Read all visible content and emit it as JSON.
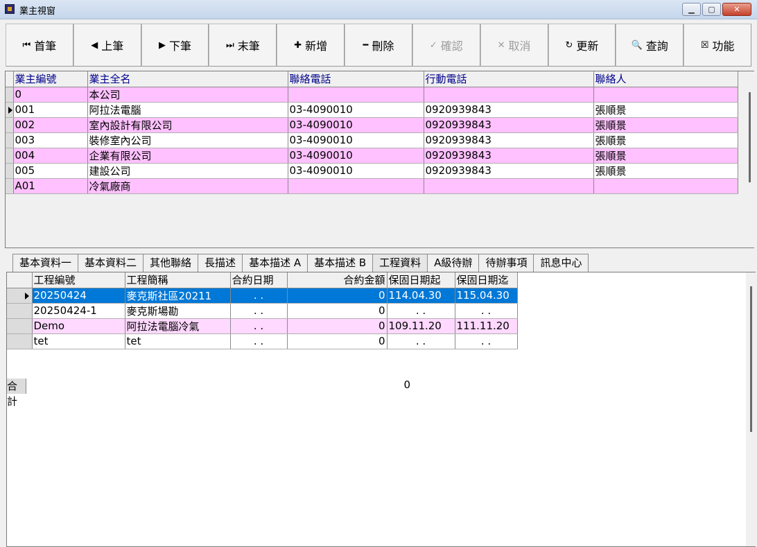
{
  "window": {
    "title": "業主視窗"
  },
  "toolbar": {
    "buttons": [
      {
        "icon": "⏮",
        "label": "首筆",
        "enabled": true
      },
      {
        "icon": "◀",
        "label": "上筆",
        "enabled": true
      },
      {
        "icon": "▶",
        "label": "下筆",
        "enabled": true
      },
      {
        "icon": "⏭",
        "label": "末筆",
        "enabled": true
      },
      {
        "icon": "✚",
        "label": "新增",
        "enabled": true
      },
      {
        "icon": "━",
        "label": "刪除",
        "enabled": true
      },
      {
        "icon": "✓",
        "label": "確認",
        "enabled": false
      },
      {
        "icon": "✕",
        "label": "取消",
        "enabled": false
      },
      {
        "icon": "↻",
        "label": "更新",
        "enabled": true
      },
      {
        "icon": "🔍",
        "label": "查詢",
        "enabled": true
      },
      {
        "icon": "☒",
        "label": "功能",
        "enabled": true
      }
    ]
  },
  "owners": {
    "columns": [
      "業主編號",
      "業主全名",
      "聯絡電話",
      "行動電話",
      "聯絡人"
    ],
    "rows": [
      {
        "id": "0",
        "name": "本公司",
        "phone": "",
        "mobile": "",
        "contact": ""
      },
      {
        "id": "001",
        "name": "阿拉法電腦",
        "phone": "03-4090010",
        "mobile": "0920939843",
        "contact": "張順景"
      },
      {
        "id": "002",
        "name": "室內設計有限公司",
        "phone": "03-4090010",
        "mobile": "0920939843",
        "contact": "張順景"
      },
      {
        "id": "003",
        "name": "裝修室內公司",
        "phone": "03-4090010",
        "mobile": "0920939843",
        "contact": "張順景"
      },
      {
        "id": "004",
        "name": "企業有限公司",
        "phone": "03-4090010",
        "mobile": "0920939843",
        "contact": "張順景"
      },
      {
        "id": "005",
        "name": "建設公司",
        "phone": "03-4090010",
        "mobile": "0920939843",
        "contact": "張順景"
      },
      {
        "id": "A01",
        "name": "冷氣廠商",
        "phone": "",
        "mobile": "",
        "contact": ""
      }
    ]
  },
  "tabs": [
    "基本資料一",
    "基本資料二",
    "其他聯絡",
    "長描述",
    "基本描述 A",
    "基本描述 B",
    "工程資料",
    "A級待辦",
    "待辦事項",
    "訊息中心"
  ],
  "projects": {
    "columns": [
      "工程編號",
      "工程簡稱",
      "合約日期",
      "合約金額",
      "保固日期起",
      "保固日期迄"
    ],
    "rows": [
      {
        "id": "20250424",
        "name": "麥克斯社區20211",
        "date": ". .",
        "amount": "0",
        "start": "114.04.30",
        "end": "115.04.30"
      },
      {
        "id": "20250424-1",
        "name": "麥克斯場勘",
        "date": ". .",
        "amount": "0",
        "start": ". .",
        "end": ". ."
      },
      {
        "id": "Demo",
        "name": "阿拉法電腦冷氣",
        "date": ". .",
        "amount": "0",
        "start": "109.11.20",
        "end": "111.11.20"
      },
      {
        "id": "tet",
        "name": "tet",
        "date": ". .",
        "amount": "0",
        "start": ". .",
        "end": ". ."
      }
    ],
    "total_label": "合計",
    "total_value": "0"
  }
}
